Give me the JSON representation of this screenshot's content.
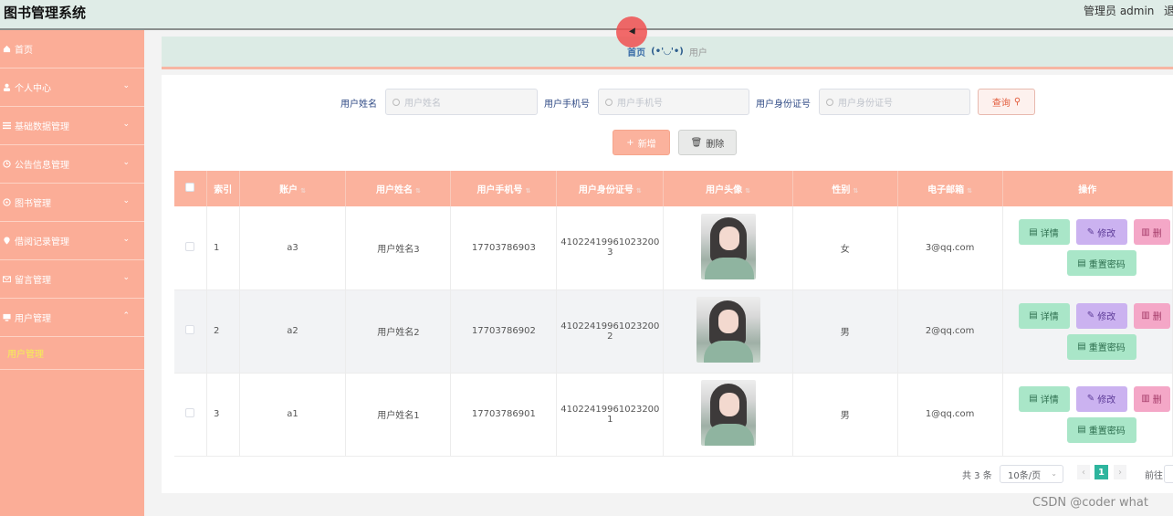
{
  "header": {
    "title": "图书管理系统",
    "admin": "管理员 admin",
    "logout": "退"
  },
  "sidebar": {
    "items": [
      {
        "label": "首页",
        "icon": "home-icon",
        "expandable": false
      },
      {
        "label": "个人中心",
        "icon": "user-icon",
        "expandable": true
      },
      {
        "label": "基础数据管理",
        "icon": "list-icon",
        "expandable": true
      },
      {
        "label": "公告信息管理",
        "icon": "clock-icon",
        "expandable": true
      },
      {
        "label": "图书管理",
        "icon": "book-icon",
        "expandable": true
      },
      {
        "label": "借阅记录管理",
        "icon": "location-icon",
        "expandable": true
      },
      {
        "label": "留言管理",
        "icon": "mail-icon",
        "expandable": true
      },
      {
        "label": "用户管理",
        "icon": "monitor-icon",
        "expandable": true,
        "expanded": true
      }
    ],
    "sub_item": "用户管理"
  },
  "breadcrumb": {
    "home": "首页",
    "separator": "(•'◡'•)",
    "current": "用户"
  },
  "search": {
    "fields": [
      {
        "label": "用户姓名",
        "placeholder": "用户姓名"
      },
      {
        "label": "用户手机号",
        "placeholder": "用户手机号"
      },
      {
        "label": "用户身份证号",
        "placeholder": "用户身份证号"
      }
    ],
    "query_label": "查询"
  },
  "actions": {
    "add_label": "新增",
    "delete_label": "删除"
  },
  "table": {
    "headers": [
      "索引",
      "账户",
      "用户姓名",
      "用户手机号",
      "用户身份证号",
      "用户头像",
      "性别",
      "电子邮箱",
      "操作"
    ],
    "rows": [
      {
        "index": "1",
        "account": "a3",
        "name": "用户姓名3",
        "phone": "17703786903",
        "idcard": "41022419961023200",
        "idcard2": "3",
        "gender": "女",
        "email": "3@qq.com"
      },
      {
        "index": "2",
        "account": "a2",
        "name": "用户姓名2",
        "phone": "17703786902",
        "idcard": "41022419961023200",
        "idcard2": "2",
        "gender": "男",
        "email": "2@qq.com"
      },
      {
        "index": "3",
        "account": "a1",
        "name": "用户姓名1",
        "phone": "17703786901",
        "idcard": "41022419961023200",
        "idcard2": "1",
        "gender": "男",
        "email": "1@qq.com"
      }
    ],
    "op_labels": {
      "detail": "详情",
      "edit": "修改",
      "delete": "删",
      "reset": "重置密码"
    }
  },
  "pagination": {
    "total": "共 3 条",
    "page_size": "10条/页",
    "current": "1",
    "goto": "前往"
  },
  "watermark": "CSDN @coder what",
  "colors": {
    "accent": "#fbb29d",
    "sidebar": "#fbad97",
    "header": "#dfece7",
    "page_active": "#2eb59e"
  }
}
